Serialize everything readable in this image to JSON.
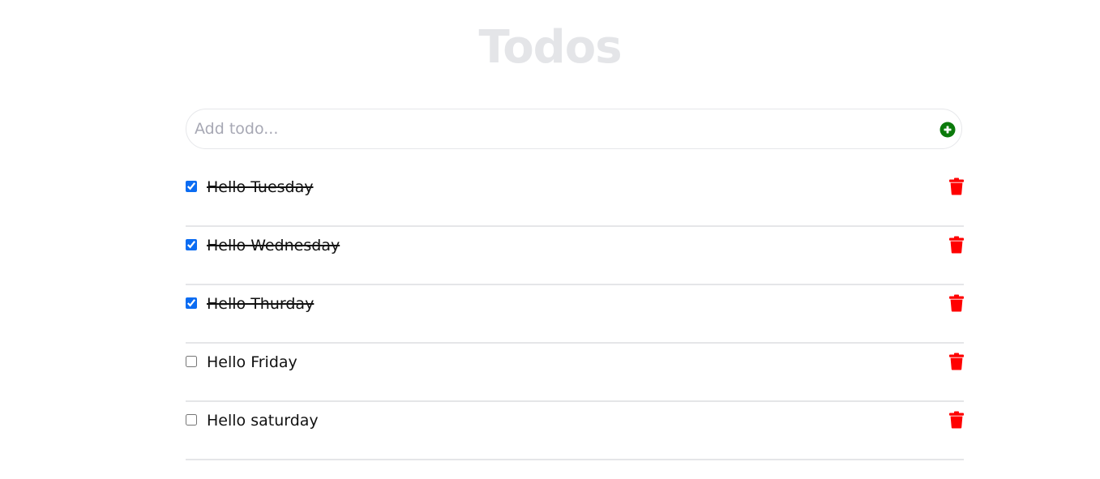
{
  "header": {
    "title": "Todos"
  },
  "add_form": {
    "placeholder": "Add todo...",
    "value": "",
    "add_icon": "plus-circle-icon",
    "add_icon_color": "#0b7a0b"
  },
  "todos": [
    {
      "text": "Hello Tuesday",
      "completed": true
    },
    {
      "text": "Hello Wednesday",
      "completed": true
    },
    {
      "text": "Hello Thurday",
      "completed": true
    },
    {
      "text": "Hello Friday",
      "completed": false
    },
    {
      "text": "Hello saturday",
      "completed": false
    }
  ],
  "colors": {
    "title": "#e4e5e8",
    "delete_icon": "#ff0000",
    "checkbox_accent": "#0b6cf2"
  },
  "icons": {
    "delete": "trash-icon"
  }
}
